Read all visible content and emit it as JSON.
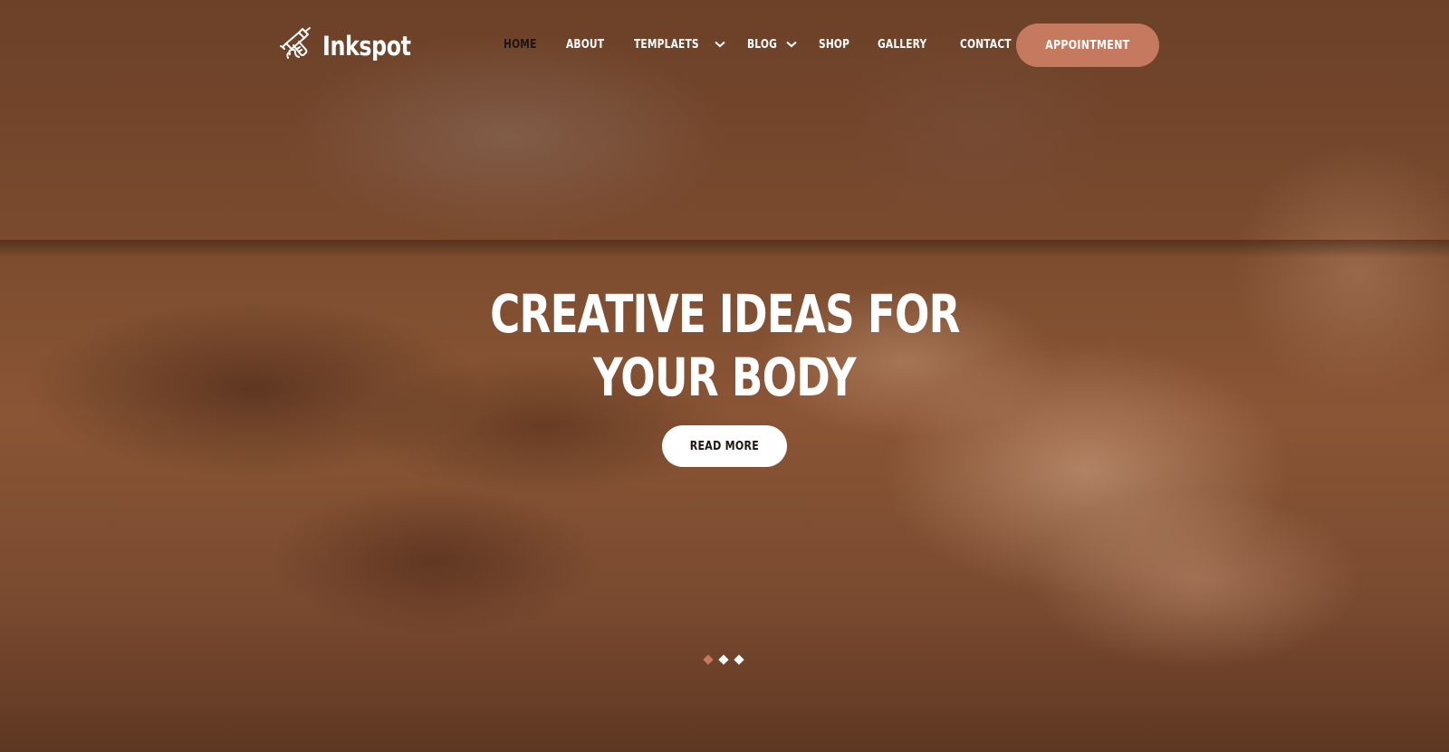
{
  "brand": {
    "name": "Inkspot",
    "logo_icon": "tattoo-machine-icon"
  },
  "nav": {
    "items": [
      {
        "label": "HOME",
        "active": true,
        "has_dropdown": false
      },
      {
        "label": "ABOUT",
        "active": false,
        "has_dropdown": false
      },
      {
        "label": "TEMPLAETS",
        "active": false,
        "has_dropdown": true
      },
      {
        "label": "BLOG",
        "active": false,
        "has_dropdown": true
      },
      {
        "label": "SHOP",
        "active": false,
        "has_dropdown": false
      },
      {
        "label": "GALLERY",
        "active": false,
        "has_dropdown": false
      },
      {
        "label": "CONTACT",
        "active": false,
        "has_dropdown": false
      }
    ],
    "cta_label": "APPOINTMENT"
  },
  "hero": {
    "headline_line1": "CREATIVE IDEAS FOR",
    "headline_line2": "YOUR BODY",
    "button_label": "READ MORE",
    "slides": {
      "count": 3,
      "active_index": 0
    }
  },
  "colors": {
    "accent": "#c57a5f",
    "text_light": "#ffffff",
    "text_dark": "#1e1410"
  }
}
